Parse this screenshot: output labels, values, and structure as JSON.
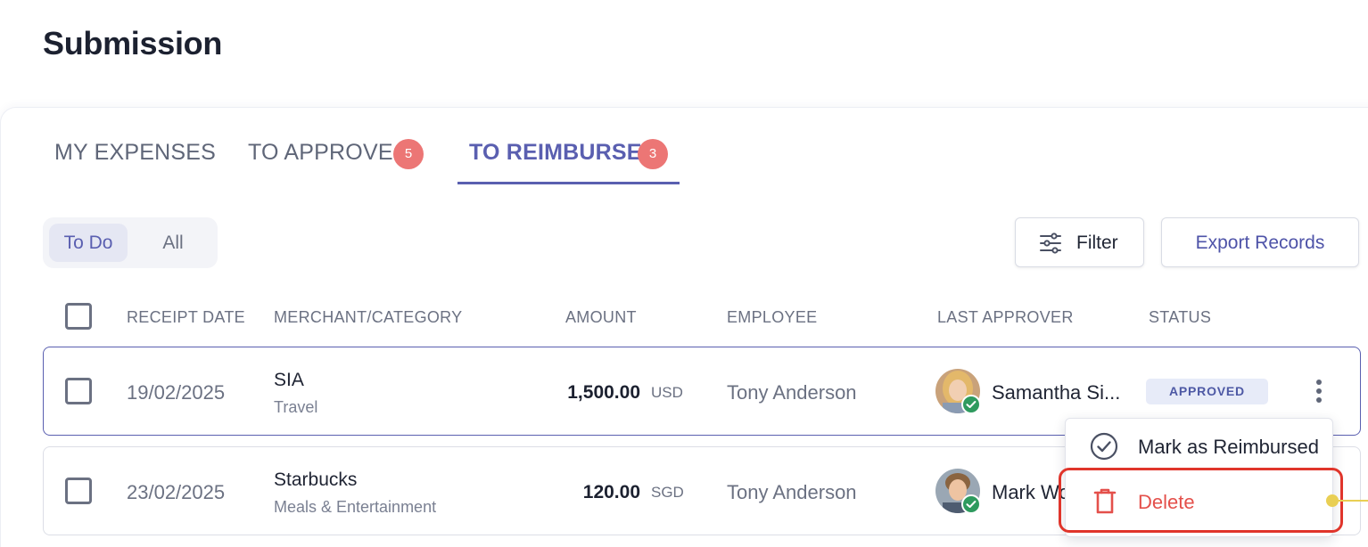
{
  "page": {
    "title": "Submission"
  },
  "tabs": [
    {
      "label": "MY EXPENSES"
    },
    {
      "label": "TO APPROVE",
      "badge": "5"
    },
    {
      "label": "TO REIMBURSE",
      "badge": "3",
      "active": true
    }
  ],
  "segment": {
    "todo": "To Do",
    "all": "All",
    "selected": "To Do"
  },
  "toolbar": {
    "filter_label": "Filter",
    "export_label": "Export Records"
  },
  "table": {
    "headers": {
      "receipt_date": "RECEIPT DATE",
      "merchant": "MERCHANT/CATEGORY",
      "amount": "AMOUNT",
      "employee": "EMPLOYEE",
      "last_approver": "LAST APPROVER",
      "status": "STATUS"
    },
    "rows": [
      {
        "date": "19/02/2025",
        "merchant": "SIA",
        "category": "Travel",
        "amount": "1,500.00",
        "currency": "USD",
        "employee": "Tony Anderson",
        "approver": "Samantha Si...",
        "status": "APPROVED"
      },
      {
        "date": "23/02/2025",
        "merchant": "Starbucks",
        "category": "Meals & Entertainment",
        "amount": "120.00",
        "currency": "SGD",
        "employee": "Tony Anderson",
        "approver": "Mark Wo"
      }
    ]
  },
  "context_menu": {
    "items": [
      {
        "label": "Mark as Reimbursed",
        "icon": "check-circle-icon"
      },
      {
        "label": "Delete",
        "icon": "trash-icon",
        "color": "#e4504b"
      }
    ]
  },
  "colors": {
    "accent": "#5a5fb0",
    "badge": "#ec7675",
    "danger": "#e4504b",
    "success": "#2e9a5e",
    "highlight": "#e0352b"
  }
}
